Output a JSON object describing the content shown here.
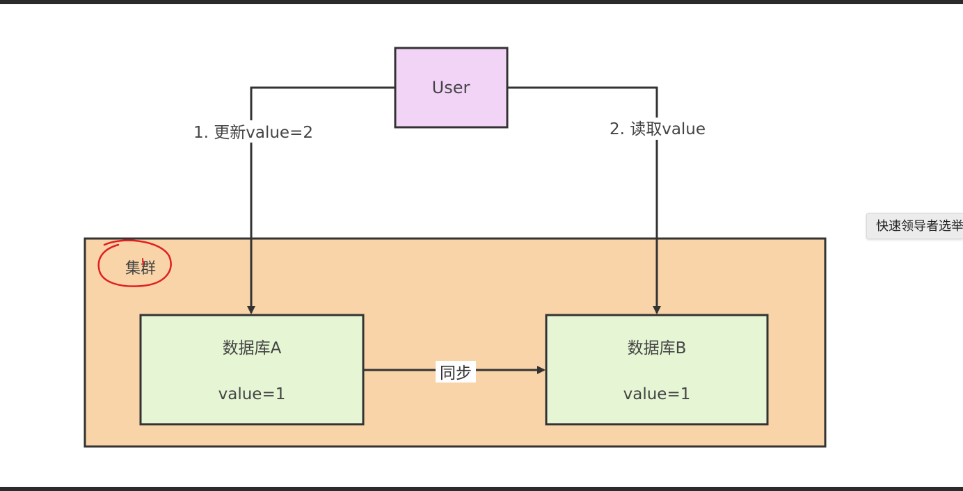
{
  "diagram": {
    "user_label": "User",
    "edge_update_label": "1. 更新value=2",
    "edge_read_label": "2. 读取value",
    "cluster_label": "集群",
    "db_a": {
      "title": "数据库A",
      "value": "value=1"
    },
    "db_b": {
      "title": "数据库B",
      "value": "value=1"
    },
    "sync_label": "同步"
  },
  "tooltip": {
    "text": "快速领导者选举"
  },
  "colors": {
    "user_fill": "#f2d4f7",
    "cluster_fill": "#f8d4a8",
    "db_fill": "#e6f6d4",
    "stroke": "#333333",
    "annotation": "#e02020"
  }
}
